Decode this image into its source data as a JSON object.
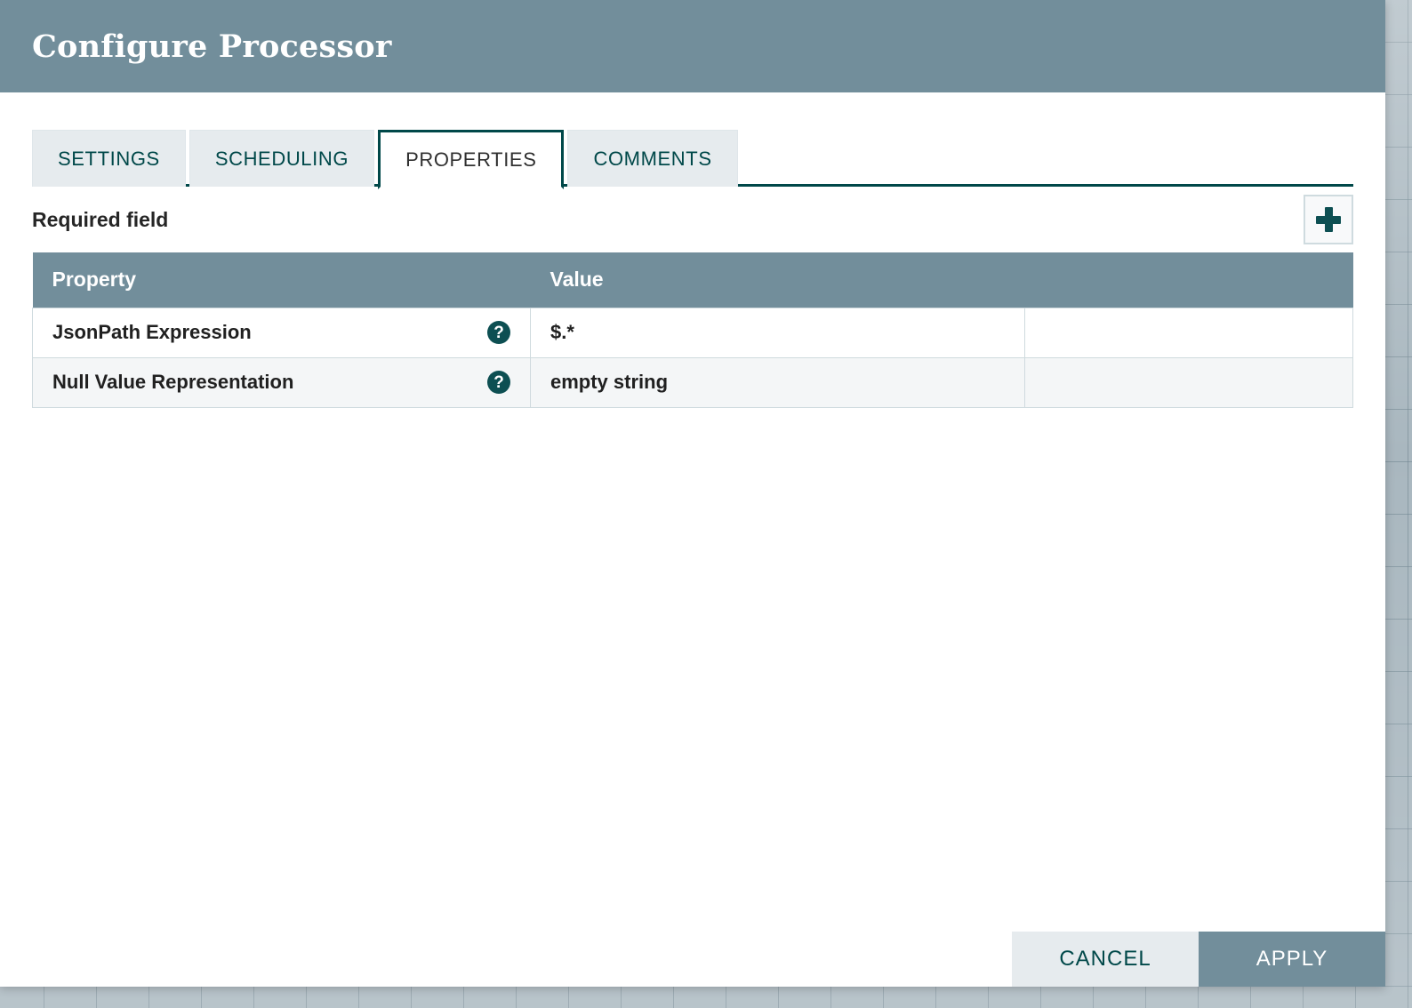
{
  "dialog": {
    "title": "Configure Processor"
  },
  "tabs": [
    {
      "label": "SETTINGS",
      "active": false
    },
    {
      "label": "SCHEDULING",
      "active": false
    },
    {
      "label": "PROPERTIES",
      "active": true
    },
    {
      "label": "COMMENTS",
      "active": false
    }
  ],
  "toolbar": {
    "required_field_label": "Required field",
    "add_property_icon": "plus-icon"
  },
  "table": {
    "headers": {
      "property": "Property",
      "value": "Value"
    },
    "rows": [
      {
        "property": "JsonPath Expression",
        "value": "$.*",
        "help_icon": "help-circle-icon"
      },
      {
        "property": "Null Value Representation",
        "value": "empty string",
        "help_icon": "help-circle-icon"
      }
    ]
  },
  "footer": {
    "cancel_label": "CANCEL",
    "apply_label": "APPLY"
  },
  "colors": {
    "header_bar": "#728e9b",
    "accent_teal": "#004849",
    "tab_inactive_bg": "#e6ebee",
    "table_header_bg": "#728e9b",
    "row_alt_bg": "#f4f6f7",
    "border": "#cfdade",
    "apply_bg": "#728e9b"
  }
}
